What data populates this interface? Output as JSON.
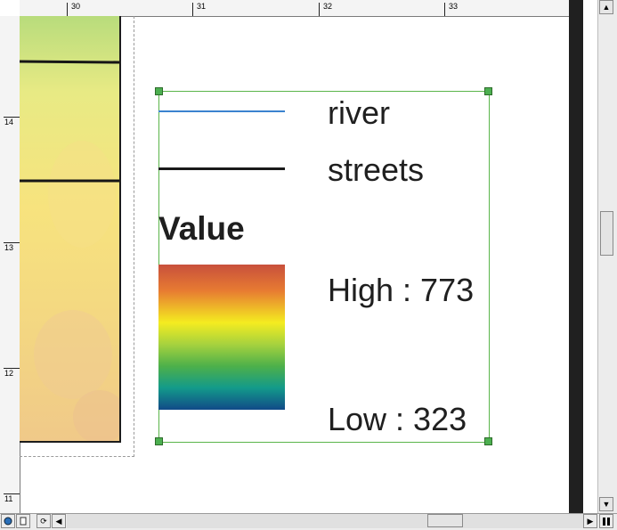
{
  "ruler_top": {
    "labels": [
      "30",
      "31",
      "32",
      "33"
    ]
  },
  "ruler_left": {
    "labels": [
      "14",
      "13",
      "12",
      "11"
    ]
  },
  "legend": {
    "items": [
      {
        "label": "river",
        "color": "#3b83cf"
      },
      {
        "label": "streets",
        "color": "#1a1a1a"
      }
    ],
    "value_heading": "Value",
    "high_label": "High : 773",
    "low_label": "Low : 323"
  },
  "colors": {
    "selection": "#5ab54a",
    "ramp": [
      "#c8503c",
      "#e77b32",
      "#f4ec20",
      "#a6d23e",
      "#4db04a",
      "#139a8a",
      "#114a88"
    ]
  },
  "bottom_bar": {
    "icons": [
      "globe-icon",
      "page-icon",
      "refresh-icon",
      "pause-icon"
    ]
  }
}
